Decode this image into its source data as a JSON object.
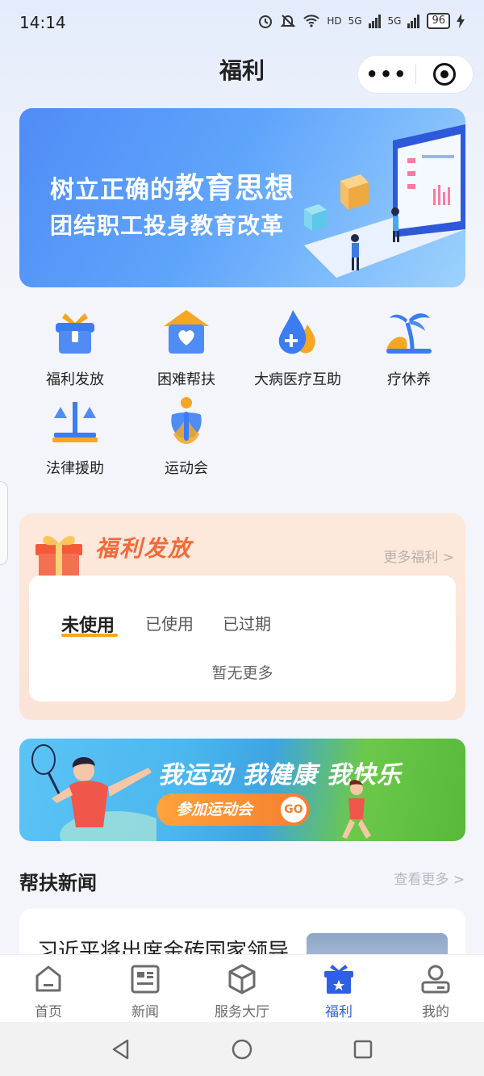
{
  "status_bar": {
    "time": "14:14",
    "battery": "96",
    "network_label_1": "5G",
    "network_label_2": "5G",
    "hd_label": "HD"
  },
  "nav": {
    "title": "福利",
    "more_icon": "ellipsis-icon",
    "close_icon": "target-icon"
  },
  "banner": {
    "line1_prefix": "树立正确的",
    "line1_emphasis": "教育思想",
    "line2": "团结职工投身教育改革"
  },
  "services": [
    {
      "label": "福利发放",
      "icon": "gift-icon"
    },
    {
      "label": "困难帮扶",
      "icon": "heart-house-icon"
    },
    {
      "label": "大病医疗互助",
      "icon": "medical-drop-icon"
    },
    {
      "label": "疗休养",
      "icon": "palm-beach-icon"
    },
    {
      "label": "法律援助",
      "icon": "scale-icon"
    },
    {
      "label": "运动会",
      "icon": "athlete-icon"
    }
  ],
  "welfare": {
    "title": "福利发放",
    "more": "更多福利 >",
    "tabs": [
      "未使用",
      "已使用",
      "已过期"
    ],
    "active_tab": "未使用",
    "empty_text": "暂无更多"
  },
  "sport_banner": {
    "slogan": "我运动 我健康 我快乐",
    "button_label": "参加运动会",
    "go_label": "GO"
  },
  "news": {
    "heading": "帮扶新闻",
    "more": "查看更多 >",
    "first_item_title": "习近平将出席金砖国家领导"
  },
  "tabbar": [
    {
      "label": "首页",
      "icon": "home-icon",
      "active": false
    },
    {
      "label": "新闻",
      "icon": "news-icon",
      "active": false
    },
    {
      "label": "服务大厅",
      "icon": "cube-icon",
      "active": false
    },
    {
      "label": "福利",
      "icon": "welfare-icon",
      "active": true
    },
    {
      "label": "我的",
      "icon": "user-icon",
      "active": false
    }
  ],
  "colors": {
    "accent_blue": "#2f5fe8",
    "welfare_orange": "#f26a3a",
    "tab_underline": "#f5a623"
  }
}
